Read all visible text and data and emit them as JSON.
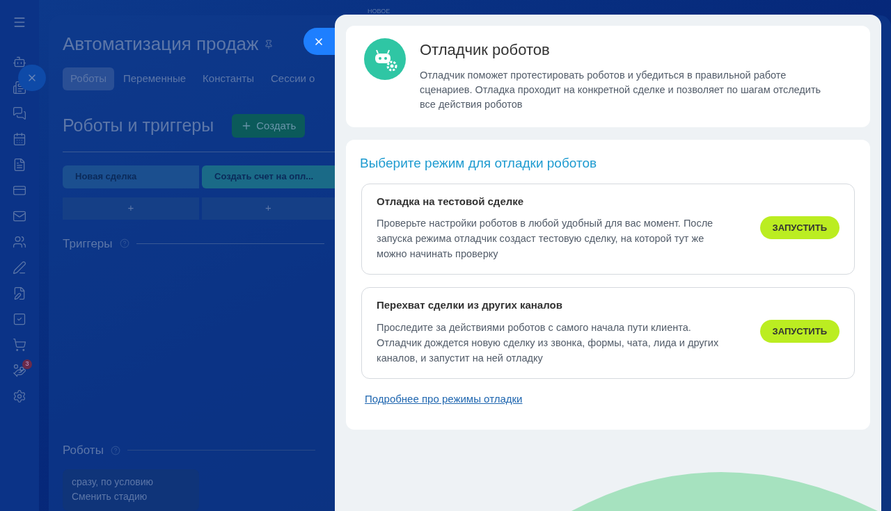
{
  "top_badge": "НОВОЕ",
  "sidebar": {
    "badge": "3"
  },
  "page": {
    "title": "Автоматизация продаж",
    "tabs": [
      {
        "label": "Роботы",
        "selected": true
      },
      {
        "label": "Переменные",
        "selected": false
      },
      {
        "label": "Константы",
        "selected": false
      },
      {
        "label": "Сессии о",
        "selected": false
      }
    ],
    "heading": "Роботы и триггеры",
    "create_button": "Создать",
    "stages": [
      {
        "label": "Новая сделка",
        "color": "#1b4f8f"
      },
      {
        "label": "Создать счет на опл...",
        "color": "#1a6a87"
      }
    ],
    "add_buttons": [
      "+",
      "+"
    ],
    "triggers_label": "Триггеры",
    "robots_label": "Роботы",
    "robot_card": {
      "condition": "сразу, по условию",
      "action": "Сменить стадию"
    }
  },
  "slider": {
    "title": "Отладчик роботов",
    "description": "Отладчик поможет протестировать роботов и убедиться в правильной работе сценариев. Отладка проходит на конкретной сделке и позволяет по шагам отследить все действия роботов",
    "mode_heading": "Выберите режим для отладки роботов",
    "modes": [
      {
        "title": "Отладка на тестовой сделке",
        "description": "Проверьте настройки роботов в любой удобный для вас момент. После запуска режима отладчик создаст тестовую сделку, на которой тут же можно начинать проверку",
        "button": "ЗАПУСТИТЬ"
      },
      {
        "title": "Перехват сделки из других каналов",
        "description": "Проследите за действиями роботов с самого начала пути клиента. Отладчик дождется новую сделку из звонка, формы, чата, лида и других каналов, и запустит на ней отладку",
        "button": "ЗАПУСТИТЬ"
      }
    ],
    "link": "Подробнее про режимы отладки"
  }
}
